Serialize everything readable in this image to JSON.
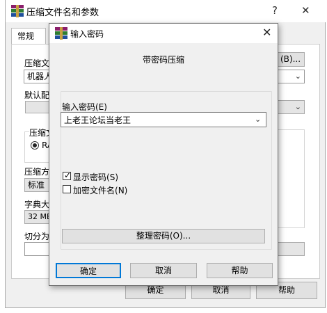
{
  "background_window": {
    "title": "压缩文件名和参数",
    "help_glyph": "?",
    "close_glyph": "✕",
    "tab_general": "常规",
    "archive_name_label": "压缩文",
    "archive_name_value": "机器人",
    "browse_button": "(B)...",
    "default_profile_label": "默认配",
    "format_group_label": "压缩文",
    "format_radio_rar": "RA",
    "method_label": "压缩方",
    "method_value": "标准",
    "dictionary_label": "字典大",
    "dictionary_value": "32 MB",
    "split_label": "切分为",
    "ok_button": "确定",
    "cancel_button": "取消",
    "help_button": "帮助"
  },
  "dialog": {
    "title": "输入密码",
    "close_glyph": "✕",
    "heading": "带密码压缩",
    "password_label": "输入密码",
    "password_label_key": "(E)",
    "password_value": "上老王论坛当老王",
    "show_password_label": "显示密码",
    "show_password_key": "(S)",
    "show_password_checked": true,
    "encrypt_names_label": "加密文件名",
    "encrypt_names_key": "(N)",
    "encrypt_names_checked": false,
    "organize_button": "整理密码",
    "organize_button_key": "(O)...",
    "ok_button": "确定",
    "cancel_button": "取消",
    "help_button": "帮助"
  },
  "colors": {
    "accent": "#0078d7",
    "window_bg": "#f0f0f0"
  },
  "icons": [
    "winrar-icon",
    "chevron-down-icon",
    "close-icon",
    "help-icon",
    "check-icon"
  ]
}
